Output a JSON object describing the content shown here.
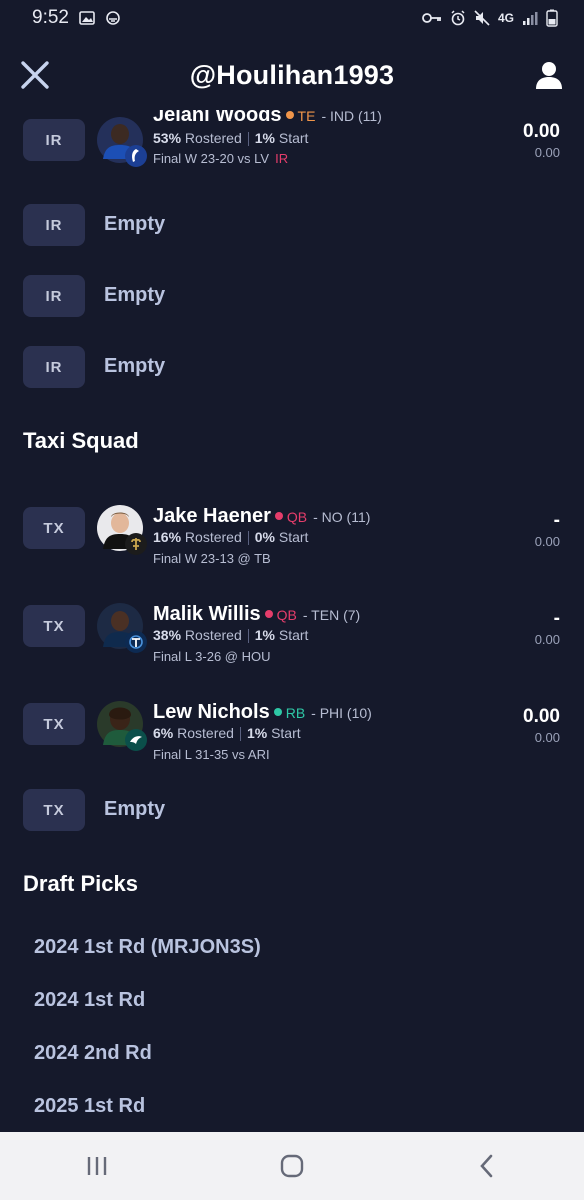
{
  "status_bar": {
    "time": "9:52",
    "network": "4G"
  },
  "header": {
    "title": "@Houlihan1993"
  },
  "ir_slots": [
    {
      "slot": "IR",
      "player": {
        "name": "Jelani Woods",
        "position": "TE",
        "team_info": "- IND (11)",
        "position_color": "#f0954a",
        "rostered_pct": "53%",
        "rostered_label": "Rostered",
        "start_pct": "1%",
        "start_label": "Start",
        "game": "Final W 23-20 vs LV",
        "status_tag": "IR",
        "score": "0.00",
        "projected": "0.00"
      }
    },
    {
      "slot": "IR",
      "empty_label": "Empty"
    },
    {
      "slot": "IR",
      "empty_label": "Empty"
    },
    {
      "slot": "IR",
      "empty_label": "Empty"
    }
  ],
  "taxi_squad": {
    "title": "Taxi Squad",
    "slots": [
      {
        "slot": "TX",
        "player": {
          "name": "Jake Haener",
          "position": "QB",
          "team_info": "- NO (11)",
          "position_color": "#e53d6b",
          "rostered_pct": "16%",
          "rostered_label": "Rostered",
          "start_pct": "0%",
          "start_label": "Start",
          "game": "Final W 23-13 @ TB",
          "score": "-",
          "projected": "0.00"
        }
      },
      {
        "slot": "TX",
        "player": {
          "name": "Malik Willis",
          "position": "QB",
          "team_info": "- TEN (7)",
          "position_color": "#e53d6b",
          "rostered_pct": "38%",
          "rostered_label": "Rostered",
          "start_pct": "1%",
          "start_label": "Start",
          "game": "Final L 3-26 @ HOU",
          "score": "-",
          "projected": "0.00"
        }
      },
      {
        "slot": "TX",
        "player": {
          "name": "Lew Nichols",
          "position": "RB",
          "team_info": "- PHI (10)",
          "position_color": "#2ec8a6",
          "rostered_pct": "6%",
          "rostered_label": "Rostered",
          "start_pct": "1%",
          "start_label": "Start",
          "game": "Final L 31-35 vs ARI",
          "score": "0.00",
          "projected": "0.00"
        }
      },
      {
        "slot": "TX",
        "empty_label": "Empty"
      }
    ]
  },
  "draft_picks": {
    "title": "Draft Picks",
    "picks": [
      "2024 1st Rd (MRJON3S)",
      "2024 1st Rd",
      "2024 2nd Rd",
      "2025 1st Rd"
    ]
  },
  "colors": {
    "background": "#15192b",
    "badge": "#2b3150",
    "empty_text": "#b9c3df",
    "ir_tag": "#e53d6b"
  }
}
